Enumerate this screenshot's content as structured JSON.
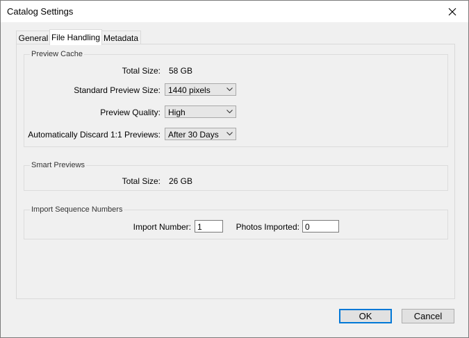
{
  "window": {
    "title": "Catalog Settings"
  },
  "tabs": [
    {
      "label": "General"
    },
    {
      "label": "File Handling"
    },
    {
      "label": "Metadata"
    }
  ],
  "preview_cache": {
    "legend": "Preview Cache",
    "total_size_label": "Total Size:",
    "total_size_value": "58 GB",
    "standard_preview_label": "Standard Preview Size:",
    "standard_preview_value": "1440 pixels",
    "quality_label": "Preview Quality:",
    "quality_value": "High",
    "discard_label": "Automatically Discard 1:1 Previews:",
    "discard_value": "After 30 Days"
  },
  "smart_previews": {
    "legend": "Smart Previews",
    "total_size_label": "Total Size:",
    "total_size_value": "26 GB"
  },
  "import_sequence": {
    "legend": "Import Sequence Numbers",
    "import_number_label": "Import Number:",
    "import_number_value": "1",
    "photos_imported_label": "Photos Imported:",
    "photos_imported_value": "0"
  },
  "buttons": {
    "ok": "OK",
    "cancel": "Cancel"
  }
}
